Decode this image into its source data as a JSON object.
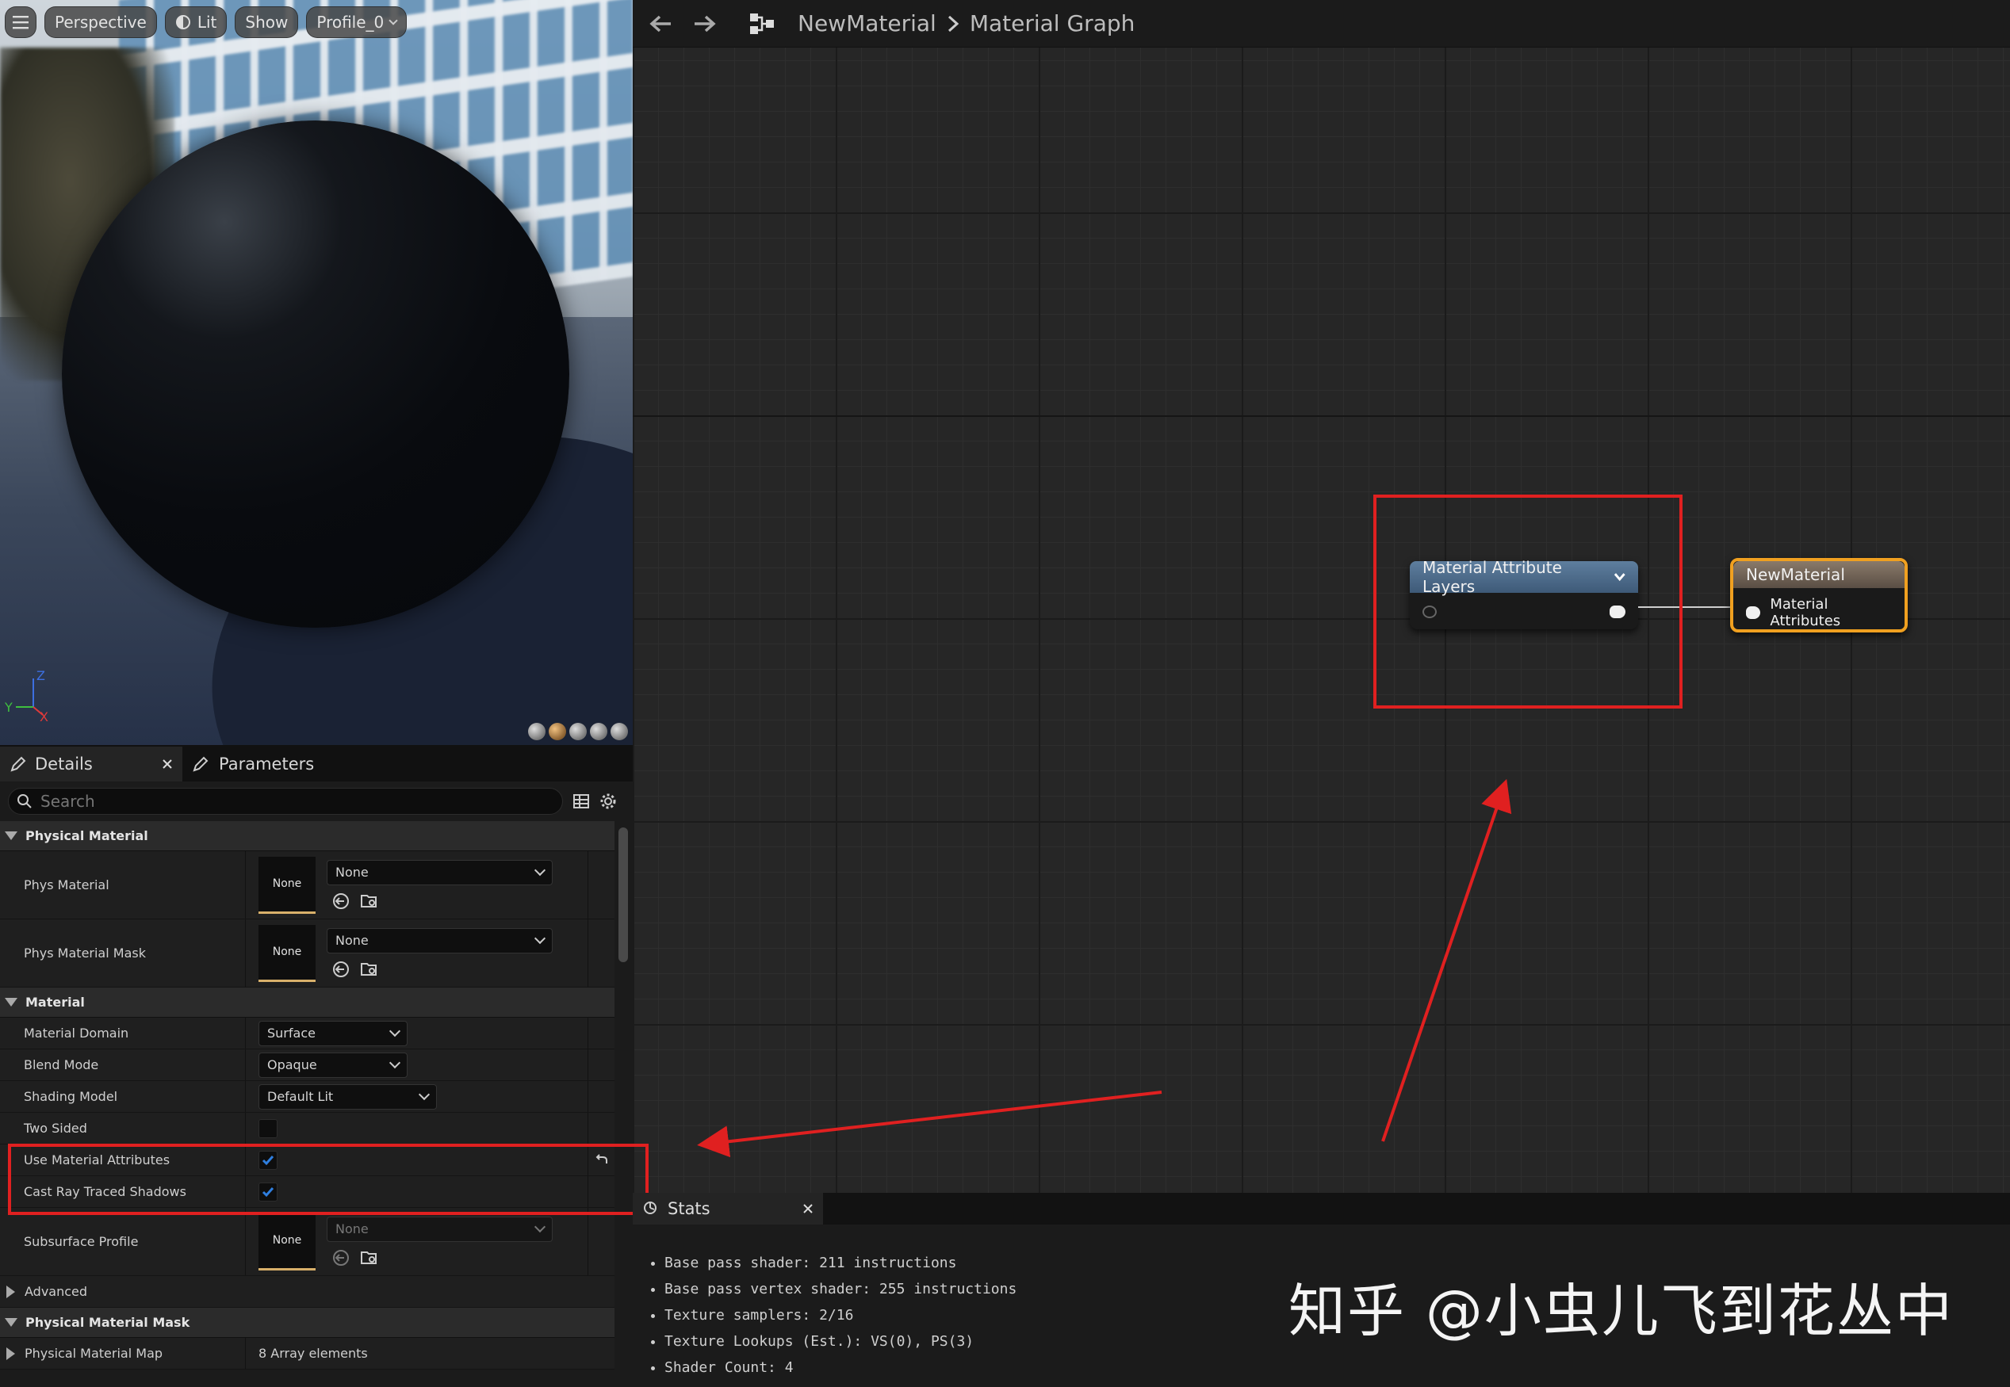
{
  "viewport": {
    "toolbar": {
      "perspective": "Perspective",
      "lit": "Lit",
      "show": "Show",
      "profile": "Profile_0"
    },
    "axes": {
      "z": "Z",
      "y": "Y",
      "x": "X"
    }
  },
  "details_panel": {
    "tabs": [
      {
        "label": "Details"
      },
      {
        "label": "Parameters"
      }
    ],
    "search_placeholder": "Search",
    "physical_material": {
      "title": "Physical Material",
      "phys_material": {
        "label": "Phys Material",
        "thumb": "None",
        "value": "None"
      },
      "phys_material_mask": {
        "label": "Phys Material Mask",
        "thumb": "None",
        "value": "None"
      }
    },
    "material": {
      "title": "Material",
      "material_domain": {
        "label": "Material Domain",
        "value": "Surface"
      },
      "blend_mode": {
        "label": "Blend Mode",
        "value": "Opaque"
      },
      "shading_model": {
        "label": "Shading Model",
        "value": "Default Lit"
      },
      "two_sided": {
        "label": "Two Sided",
        "checked": false
      },
      "use_material_attributes": {
        "label": "Use Material Attributes",
        "checked": true
      },
      "cast_ray_traced_shadows": {
        "label": "Cast Ray Traced Shadows",
        "checked": true
      },
      "subsurface_profile": {
        "label": "Subsurface Profile",
        "thumb": "None",
        "value": "None"
      }
    },
    "advanced": {
      "title": "Advanced"
    },
    "physical_material_mask": {
      "title": "Physical Material Mask",
      "physical_material_map": {
        "label": "Physical Material Map",
        "value": "8 Array elements"
      }
    }
  },
  "graph": {
    "breadcrumb": {
      "asset": "NewMaterial",
      "graph": "Material Graph"
    },
    "nodes": {
      "attribute_layers": {
        "title": "Material Attribute Layers"
      },
      "new_material": {
        "title": "NewMaterial",
        "input": "Material Attributes"
      }
    }
  },
  "stats": {
    "tab": "Stats",
    "lines": [
      "Base pass shader: 211 instructions",
      "Base pass vertex shader: 255 instructions",
      "Texture samplers: 2/16",
      "Texture Lookups (Est.): VS(0), PS(3)",
      "Shader Count: 4"
    ]
  },
  "watermark": "知乎 @小虫儿飞到花丛中",
  "colors": {
    "accent_orange": "#f0a020",
    "annotation_red": "#e02020",
    "node_header_blue": "#4f6f8f",
    "checkbox_blue": "#2f7fe0"
  }
}
